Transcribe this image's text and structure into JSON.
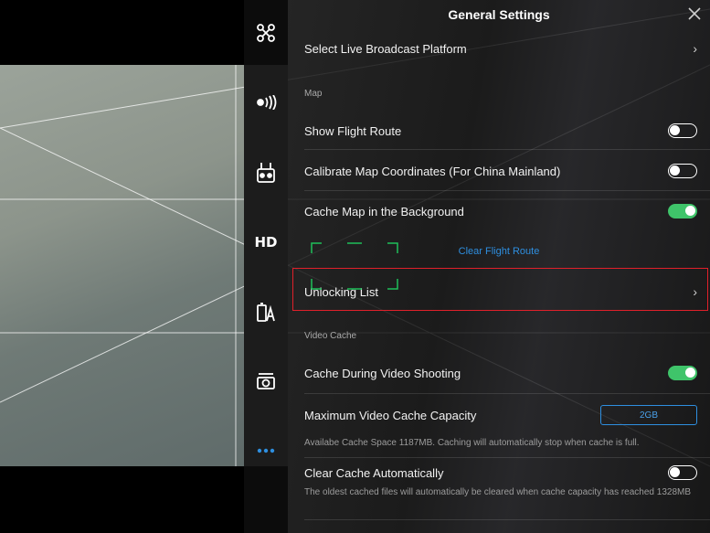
{
  "panel": {
    "title": "General Settings",
    "close_icon": "close-icon"
  },
  "sidebar": {
    "items": [
      {
        "icon": "aircraft-icon"
      },
      {
        "icon": "signal-icon"
      },
      {
        "icon": "remote-controller-icon"
      },
      {
        "label": "HD"
      },
      {
        "icon": "battery-warning-icon"
      },
      {
        "icon": "camera-icon"
      },
      {
        "icon": "more-icon"
      }
    ]
  },
  "rows": {
    "live_broadcast": "Select Live Broadcast Platform",
    "map_section": "Map",
    "show_flight_route": "Show Flight Route",
    "calibrate_map": "Calibrate Map Coordinates (For China Mainland)",
    "cache_map": "Cache Map in the Background",
    "clear_flight_route": "Clear Flight Route",
    "unlocking_list": "Unlocking List",
    "video_cache_section": "Video Cache",
    "cache_during_video": "Cache During Video Shooting",
    "max_video_cache": "Maximum Video Cache Capacity",
    "max_video_cache_value": "2GB",
    "cache_space_note": "Availabe Cache Space 1187MB. Caching will automatically stop when cache is full.",
    "clear_cache_auto": "Clear Cache Automatically",
    "clear_cache_note": "The oldest cached files will automatically be cleared when cache capacity has reached 1328MB"
  },
  "toggles": {
    "show_flight_route": false,
    "calibrate_map": false,
    "cache_map": true,
    "cache_during_video": true,
    "clear_cache_auto": false
  },
  "colors": {
    "toggle_on": "#3fc46a",
    "link": "#2e8fe0",
    "highlight": "#e0202a"
  }
}
